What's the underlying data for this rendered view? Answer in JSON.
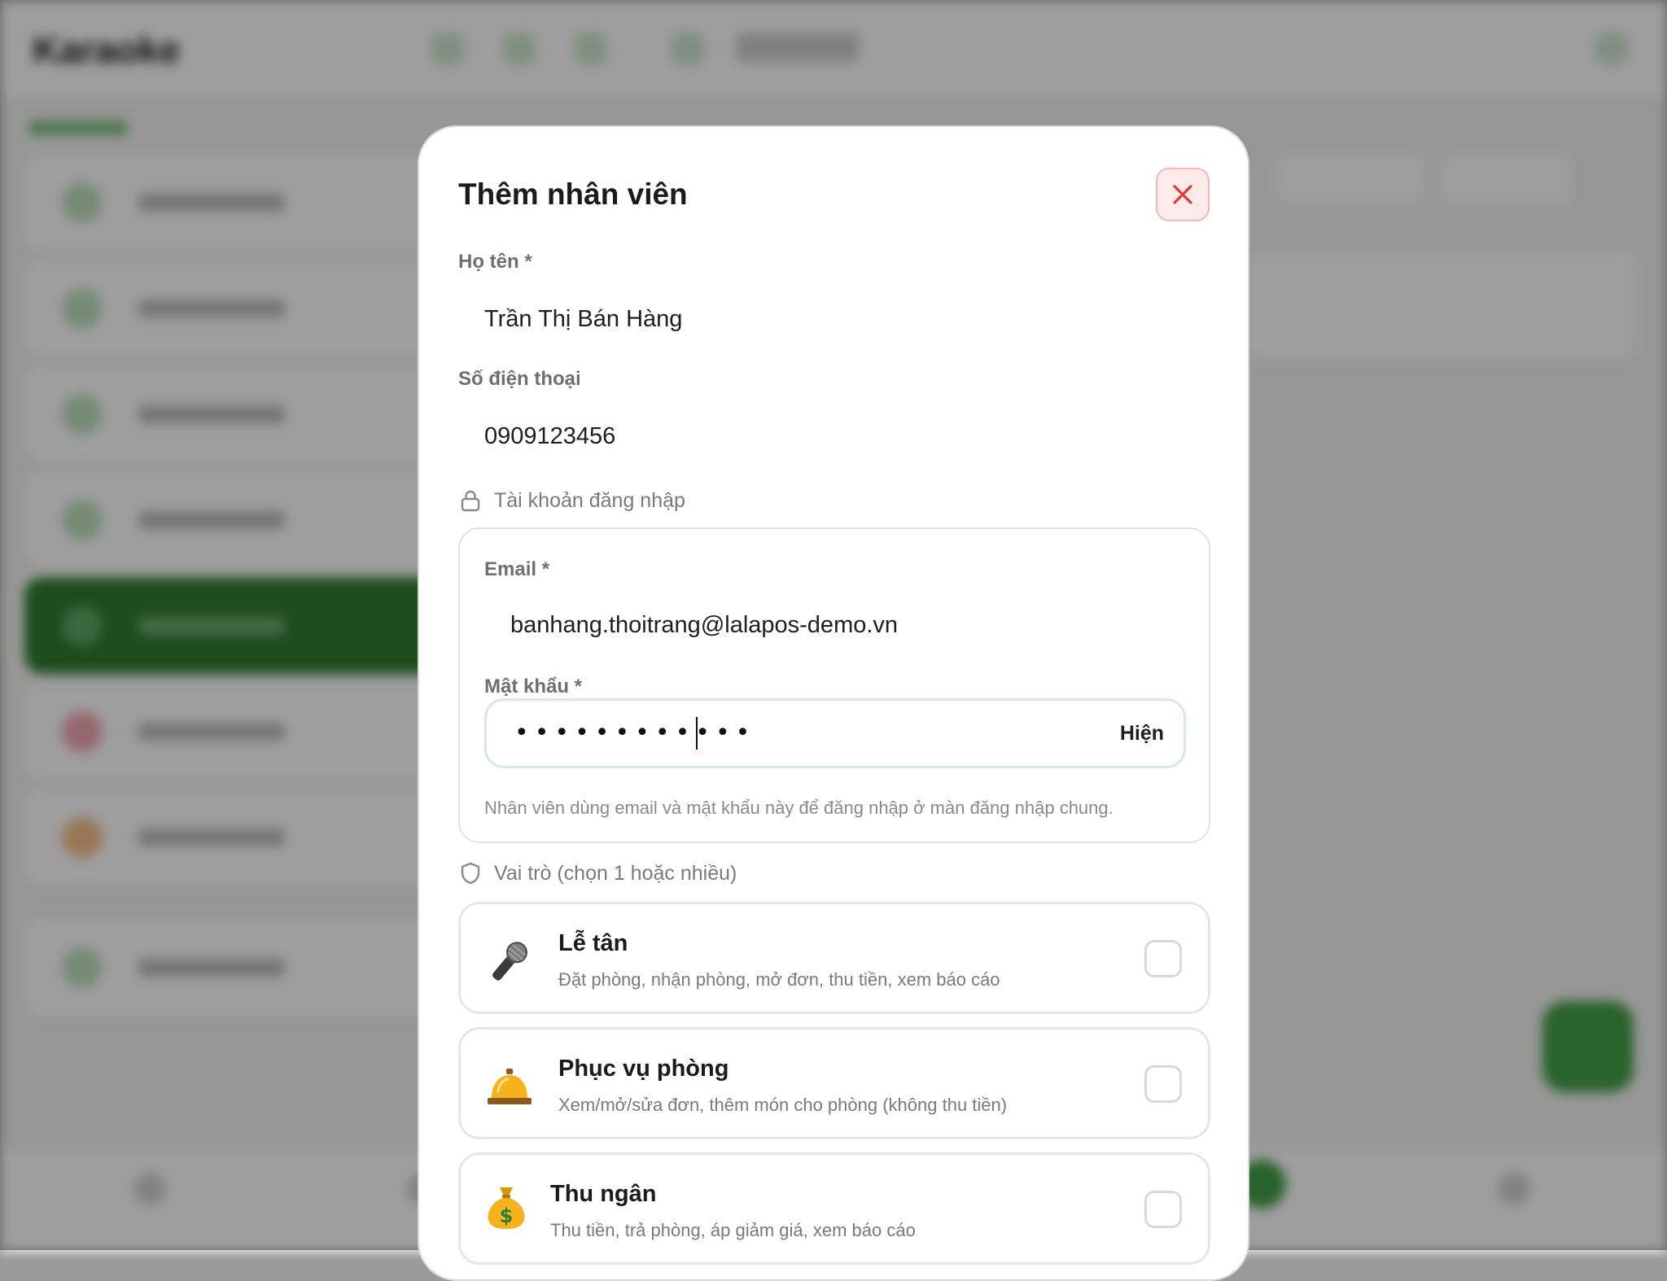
{
  "background": {
    "app_logo": "Karaoke",
    "accent_color": "#2f7d32"
  },
  "modal": {
    "title": "Thêm nhân viên",
    "close_icon": "close-icon",
    "full_name": {
      "label": "Họ tên *",
      "value": "Trần Thị Bán Hàng"
    },
    "phone": {
      "label": "Số điện thoại",
      "value": "0909123456"
    },
    "account_section": {
      "title": "Tài khoản đăng nhập",
      "icon": "lock-icon",
      "email": {
        "label": "Email *",
        "value": "banhang.thoitrang@lalapos-demo.vn"
      },
      "password": {
        "label": "Mật khẩu *",
        "masked_value": "••••••••••••",
        "show_label": "Hiện"
      },
      "hint": "Nhân viên dùng email và mật khẩu này để đăng nhập ở màn đăng nhập chung."
    },
    "roles_section": {
      "title": "Vai trò (chọn 1 hoặc nhiều)",
      "icon": "shield-icon",
      "roles": [
        {
          "name": "Lễ tân",
          "desc": "Đặt phòng, nhận phòng, mở đơn, thu tiền, xem báo cáo",
          "icon": "microphone-icon",
          "checked": false
        },
        {
          "name": "Phục vụ phòng",
          "desc": "Xem/mở/sửa đơn, thêm món cho phòng (không thu tiền)",
          "icon": "service-bell-icon",
          "checked": false
        },
        {
          "name": "Thu ngân",
          "desc": "Thu tiền, trả phòng, áp giảm giá, xem báo cáo",
          "icon": "money-bag-icon",
          "checked": false
        }
      ]
    },
    "colors": {
      "close_red": "#e53935",
      "focus_green": "#d6ecd6"
    }
  }
}
